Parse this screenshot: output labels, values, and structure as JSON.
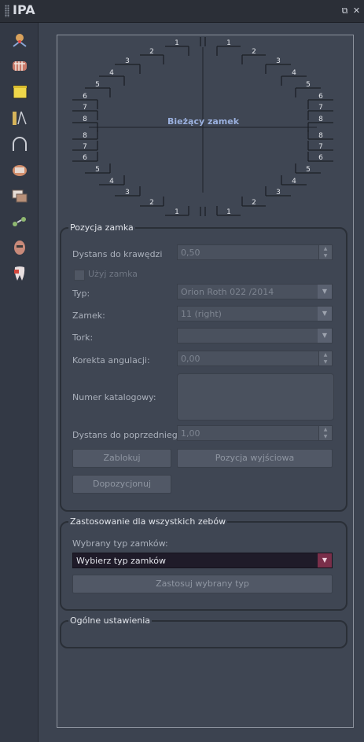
{
  "window": {
    "title": "IPA",
    "restore_icon": "restore-icon",
    "close_icon": "close-icon"
  },
  "toolbar": {
    "tools": [
      {
        "name": "axis-tool-icon",
        "color": "#d9a25c"
      },
      {
        "name": "teeth-tool-icon",
        "color": "#c97a6a"
      },
      {
        "name": "note-tool-icon",
        "color": "#f0d84a"
      },
      {
        "name": "measure-tool-icon",
        "color": "#d6b45a"
      },
      {
        "name": "arch-tool-icon",
        "color": "#c9ccd3"
      },
      {
        "name": "bracket-tool-icon",
        "color": "#d08c6a"
      },
      {
        "name": "photos-tool-icon",
        "color": "#b78f78"
      },
      {
        "name": "attachment-tool-icon",
        "color": "#8fb870"
      },
      {
        "name": "face-tool-icon",
        "color": "#c98a7a"
      },
      {
        "name": "tooth-tool-icon",
        "color": "#e8dfe0"
      }
    ]
  },
  "diagram": {
    "center_label": "Bieżący zamek",
    "tooth_numbers": [
      "1",
      "2",
      "3",
      "4",
      "5",
      "6",
      "7",
      "8"
    ]
  },
  "position": {
    "group_title": "Pozycja zamka",
    "distance_edge_label": "Dystans do krawędzi",
    "distance_edge_value": "0,50",
    "use_bracket_label": "Użyj zamka",
    "type_label": "Typ:",
    "type_value": "Orion Roth 022 /2014",
    "bracket_label": "Zamek:",
    "bracket_value": "11 (right)",
    "torque_label": "Tork:",
    "torque_value": "",
    "angulation_label": "Korekta angulacji:",
    "angulation_value": "0,00",
    "catalog_label": "Numer katalogowy:",
    "prev_distance_label": "Dystans do poprzedniego:",
    "prev_distance_value": "1,00",
    "lock_button": "Zablokuj",
    "initial_position_button": "Pozycja wyjściowa",
    "reposition_button": "Dopozycjonuj"
  },
  "apply_all": {
    "group_title": "Zastosowanie dla wszystkich zebów",
    "selected_type_label": "Wybrany typ zamków:",
    "selected_type_value": "Wybierz typ zamków",
    "apply_button": "Zastosuj wybrany typ"
  },
  "general": {
    "group_title": "Ogólne ustawienia"
  }
}
